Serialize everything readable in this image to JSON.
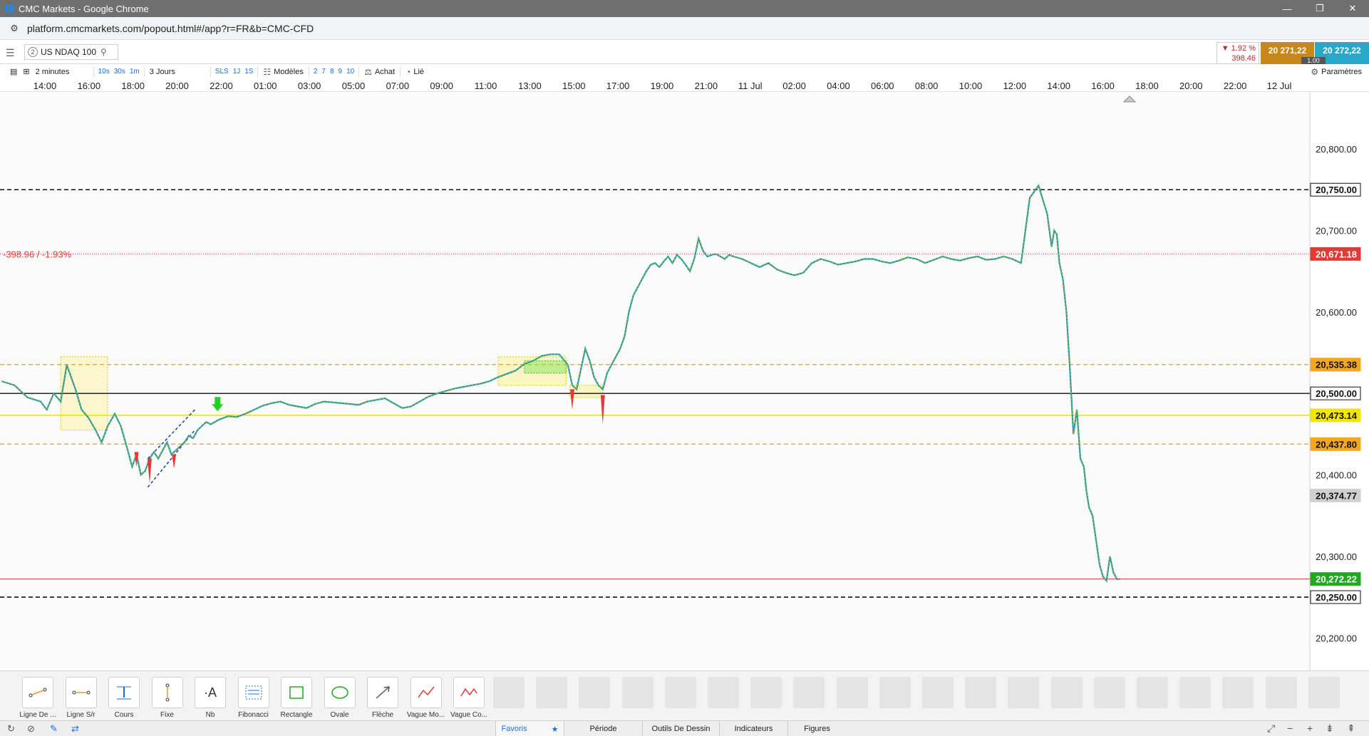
{
  "browser": {
    "window_title": "CMC Markets - Google Chrome",
    "url": "platform.cmcmarkets.com/popout.html#/app?r=FR&b=CMC-CFD",
    "controls": [
      "—",
      "❐",
      "✕"
    ]
  },
  "instrument": {
    "number": "2",
    "name": "US NDAQ 100",
    "change_pct": "▼ 1.92 %",
    "change_pts": "398.46",
    "sell_price": "20 271,22",
    "buy_price": "20 272,22",
    "spread": "1.00"
  },
  "toolbar": {
    "interval": "2 minutes",
    "quick_intervals": [
      "10s",
      "30s",
      "1m"
    ],
    "range": "3 Jours",
    "quick_ranges": [
      "SLS",
      "1J",
      "1S"
    ],
    "templates_label": "Modèles",
    "template_slots": [
      "2",
      "7",
      "8",
      "9",
      "10"
    ],
    "buy_label": "Achat",
    "link_label": "Lié",
    "settings_label": "Paramètres"
  },
  "time_axis": [
    "14:00",
    "16:00",
    "18:00",
    "20:00",
    "22:00",
    "01:00",
    "03:00",
    "05:00",
    "07:00",
    "09:00",
    "11:00",
    "13:00",
    "15:00",
    "17:00",
    "19:00",
    "21:00",
    "11 Jul",
    "02:00",
    "04:00",
    "06:00",
    "08:00",
    "10:00",
    "12:00",
    "14:00",
    "16:00",
    "18:00",
    "20:00",
    "22:00",
    "12 Jul"
  ],
  "chart_data": {
    "type": "line",
    "price_ticks": [
      "20,800.00",
      "20,700.00",
      "20,600.00",
      "20,400.00",
      "20,300.00",
      "20,200.00"
    ],
    "ylim": [
      20160,
      20870
    ],
    "change_annotation": "-398.96 / -1.93%",
    "levels": [
      {
        "label": "20,750.00",
        "value": 20750,
        "style": "black-dashed",
        "color": "#000000"
      },
      {
        "label": "20,671.18",
        "value": 20671.18,
        "style": "red-dotted",
        "color": "#e53935"
      },
      {
        "label": "20,535.38",
        "value": 20535.38,
        "style": "orange-dashed",
        "color": "#f5a623"
      },
      {
        "label": "20,500.00",
        "value": 20500,
        "style": "black-solid",
        "color": "#000000"
      },
      {
        "label": "20,473.14",
        "value": 20473.14,
        "style": "yellow-solid",
        "color": "#f2e600"
      },
      {
        "label": "20,437.80",
        "value": 20437.8,
        "style": "orange-dashed",
        "color": "#f5a623"
      },
      {
        "label": "20,374.77",
        "value": 20374.77,
        "style": "grey-tag",
        "color": "#d0d0d0"
      },
      {
        "label": "20,272.22",
        "value": 20272.22,
        "style": "green-tag",
        "color": "#1faa1f"
      },
      {
        "label": "20,250.00",
        "value": 20250,
        "style": "black-dashed",
        "color": "#000000"
      }
    ],
    "x": [
      0,
      15,
      30,
      45,
      52,
      60,
      68,
      75,
      85,
      92,
      100,
      108,
      115,
      122,
      130,
      137,
      145,
      150,
      155,
      160,
      165,
      170,
      175,
      180,
      185,
      190,
      195,
      200,
      205,
      210,
      215,
      220,
      225,
      230,
      235,
      240,
      250,
      260,
      270,
      280,
      290,
      300,
      310,
      320,
      330,
      340,
      350,
      360,
      370,
      380,
      390,
      400,
      410,
      420,
      430,
      440,
      450,
      460,
      470,
      480,
      490,
      500,
      510,
      520,
      530,
      540,
      550,
      560,
      570,
      580,
      590,
      600,
      610,
      620,
      630,
      640,
      650,
      655,
      660,
      665,
      670,
      675,
      680,
      685,
      690,
      695,
      700,
      705,
      710,
      715,
      720,
      725,
      730,
      735,
      740,
      745,
      750,
      755,
      760,
      765,
      770,
      775,
      780,
      785,
      790,
      795,
      800,
      805,
      810,
      815,
      820,
      825,
      830,
      835,
      840,
      850,
      860,
      870,
      880,
      890,
      900,
      910,
      920,
      930,
      940,
      950,
      960,
      970,
      980,
      990,
      1000,
      1010,
      1020,
      1030,
      1040,
      1050,
      1060,
      1070,
      1080,
      1090,
      1100,
      1110,
      1120,
      1130,
      1140,
      1150,
      1160,
      1170,
      1180,
      1190,
      1200,
      1205,
      1208,
      1211,
      1214,
      1218,
      1222,
      1226,
      1230,
      1234,
      1238,
      1242,
      1245,
      1248,
      1252,
      1256,
      1260,
      1264,
      1268,
      1272,
      1276,
      1280,
      1284,
      1288,
      1292
    ],
    "y": [
      20515,
      20510,
      20495,
      20490,
      20480,
      20500,
      20490,
      20535,
      20505,
      20480,
      20470,
      20455,
      20440,
      20460,
      20475,
      20460,
      20430,
      20410,
      20425,
      20400,
      20405,
      20420,
      20428,
      20420,
      20430,
      20440,
      20425,
      20430,
      20435,
      20440,
      20448,
      20445,
      20455,
      20460,
      20465,
      20462,
      20468,
      20472,
      20471,
      20475,
      20480,
      20485,
      20488,
      20490,
      20486,
      20484,
      20482,
      20487,
      20490,
      20489,
      20488,
      20487,
      20486,
      20490,
      20492,
      20494,
      20488,
      20482,
      20484,
      20490,
      20496,
      20500,
      20503,
      20506,
      20508,
      20510,
      20512,
      20515,
      20520,
      20524,
      20528,
      20536,
      20540,
      20546,
      20548,
      20548,
      20535,
      20510,
      20505,
      20530,
      20555,
      20540,
      20520,
      20510,
      20505,
      20525,
      20535,
      20545,
      20555,
      20570,
      20600,
      20620,
      20630,
      20640,
      20650,
      20658,
      20660,
      20655,
      20662,
      20668,
      20660,
      20670,
      20665,
      20658,
      20650,
      20665,
      20690,
      20675,
      20668,
      20670,
      20671,
      20668,
      20665,
      20670,
      20668,
      20665,
      20660,
      20655,
      20660,
      20652,
      20648,
      20645,
      20648,
      20660,
      20665,
      20662,
      20658,
      20660,
      20662,
      20665,
      20665,
      20662,
      20660,
      20663,
      20667,
      20665,
      20660,
      20664,
      20668,
      20665,
      20663,
      20666,
      20668,
      20664,
      20665,
      20668,
      20665,
      20660,
      20740,
      20755,
      20720,
      20680,
      20700,
      20695,
      20660,
      20640,
      20600,
      20530,
      20450,
      20480,
      20420,
      20410,
      20380,
      20360,
      20350,
      20320,
      20290,
      20275,
      20270,
      20300,
      20280,
      20272,
      20272.22
    ]
  },
  "drawing_tools": [
    "Ligne De ...",
    "Ligne S/r",
    "Cours",
    "Fixe",
    "Nb",
    "Fibonacci",
    "Rectangle",
    "Ovale",
    "Flèche",
    "Vague Mo...",
    "Vague Co..."
  ],
  "drawing_tool_icons": [
    "trend-line-icon",
    "sr-line-icon",
    "price-line-icon",
    "fixed-line-icon",
    "text-icon",
    "fibonacci-icon",
    "rectangle-icon",
    "ellipse-icon",
    "arrow-icon",
    "motive-wave-icon",
    "corrective-wave-icon"
  ],
  "bottom_tabs": [
    {
      "label": "Favoris",
      "active": true
    },
    {
      "label": "Période",
      "active": false
    },
    {
      "label": "Outils De Dessin",
      "active": false
    },
    {
      "label": "Indicateurs",
      "active": false
    },
    {
      "label": "Figures",
      "active": false
    }
  ]
}
